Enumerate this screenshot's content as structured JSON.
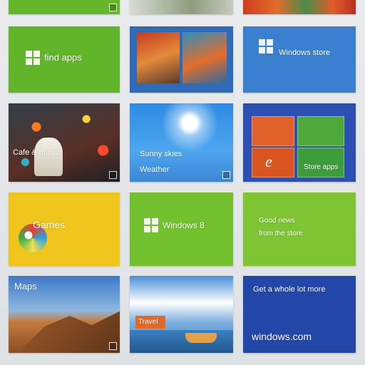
{
  "screen": {
    "background_color": "#e4e6e8"
  },
  "tiles": [
    {
      "id": "top-left-partial",
      "color": "#67b52a",
      "label": ""
    },
    {
      "id": "top-middle-partial",
      "color": "#a6b196",
      "label": ""
    },
    {
      "id": "top-right-partial",
      "color": "#cf3b1f",
      "label": ""
    },
    {
      "id": "windows-green-tile",
      "color": "#62b52b",
      "label": "find apps",
      "icon": "windows-logo-icon"
    },
    {
      "id": "photo-store-tile",
      "color": "#2f6bb8",
      "label": ""
    },
    {
      "id": "windows-blue-tile",
      "color": "#3b7fd0",
      "label": "Windows store",
      "icon": "windows-logo-icon"
    },
    {
      "id": "lights-photo-tile",
      "color": "#5a2f25",
      "label": "Cafe & music"
    },
    {
      "id": "weather-tile",
      "color": "#2c8be3",
      "label": "Sunny skies",
      "sublabel": "Weather"
    },
    {
      "id": "apps-collage-tile",
      "color": "#2b4fb3",
      "label": "Store apps"
    },
    {
      "id": "yellow-games-tile",
      "color": "#f0c51d",
      "label": "Games"
    },
    {
      "id": "windows-8-tile",
      "color": "#73c12e",
      "label": "Windows 8",
      "icon": "windows-logo-icon"
    },
    {
      "id": "green-text-tile",
      "color": "#7ec433",
      "label": "Good news",
      "sublabel": "from the store"
    },
    {
      "id": "landscape-tile",
      "color": "#3d79c9",
      "label": "Maps"
    },
    {
      "id": "harbor-tile",
      "color": "#4a90d8",
      "label": "Travel"
    },
    {
      "id": "navy-text-tile",
      "color": "#2347a8",
      "label": "Get a whole lot more",
      "sublabel": "windows.com"
    }
  ]
}
